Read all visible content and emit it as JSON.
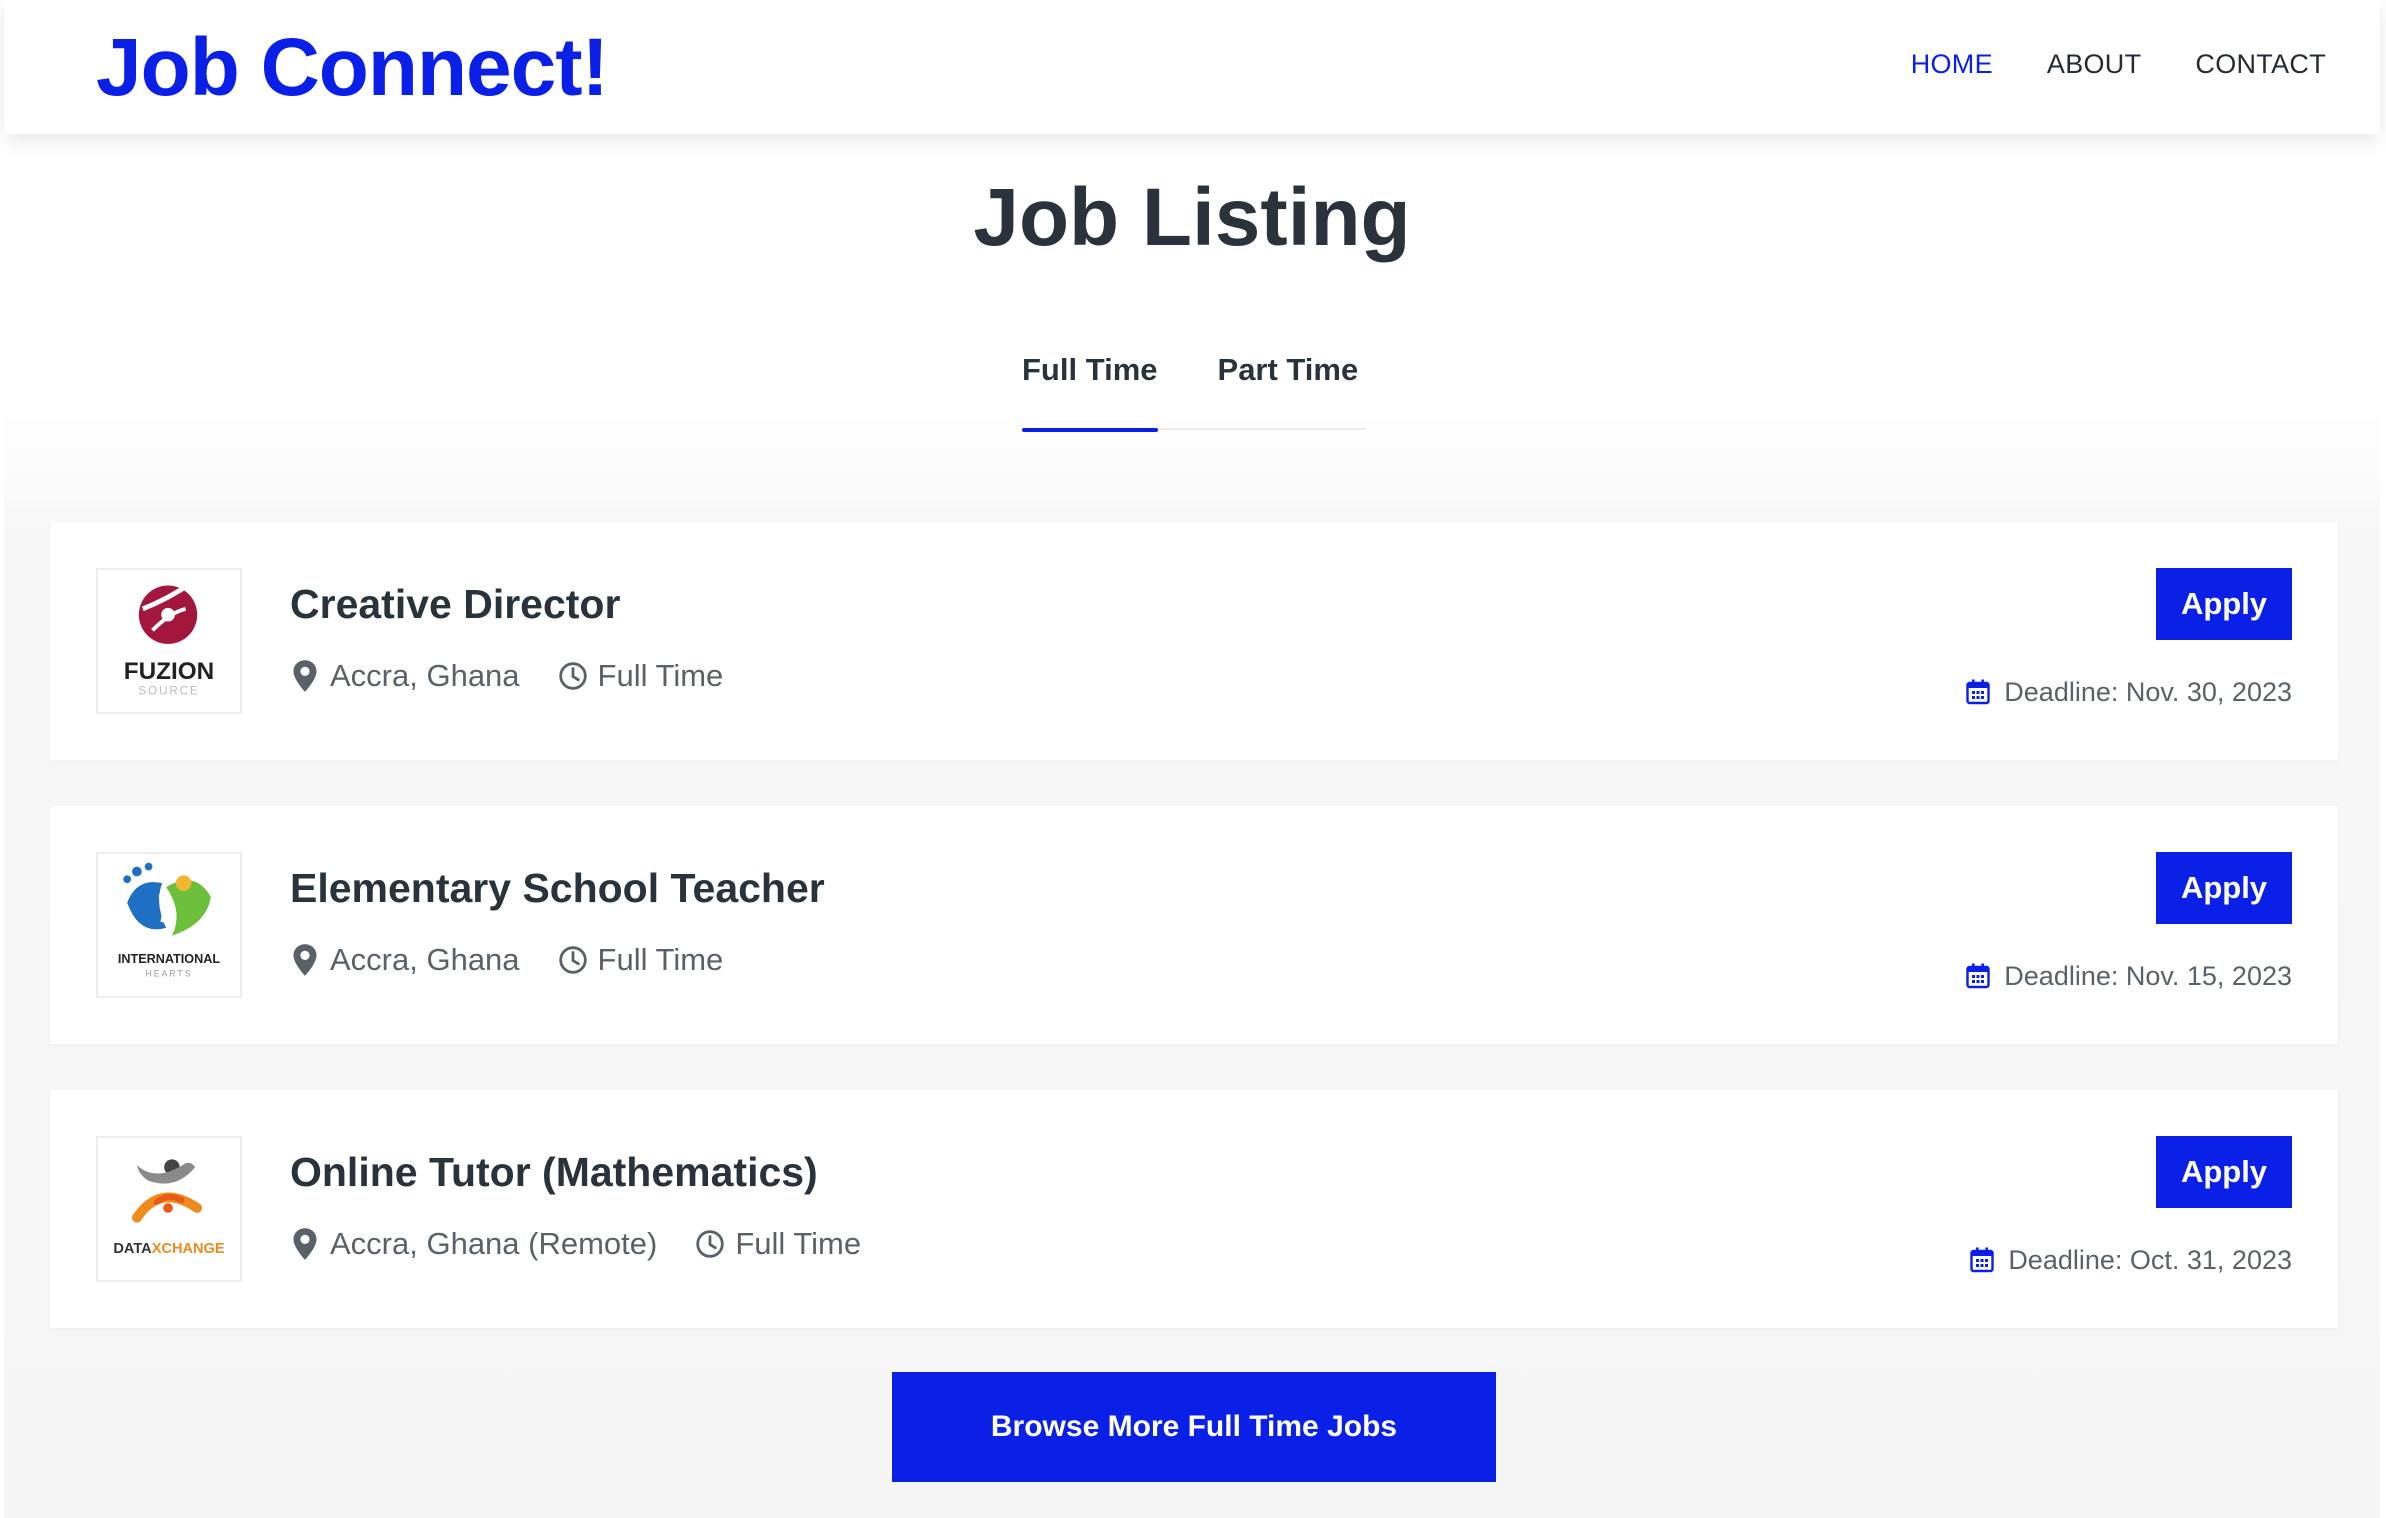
{
  "header": {
    "brand": "Job Connect!",
    "nav": [
      {
        "label": "HOME",
        "active": true
      },
      {
        "label": "ABOUT",
        "active": false
      },
      {
        "label": "CONTACT",
        "active": false
      }
    ]
  },
  "main": {
    "title": "Job Listing",
    "tabs": [
      {
        "label": "Full Time",
        "active": true
      },
      {
        "label": "Part Time",
        "active": false
      }
    ],
    "jobs": [
      {
        "title": "Creative Director",
        "location": "Accra, Ghana",
        "type": "Full Time",
        "apply_label": "Apply",
        "deadline": "Deadline: Nov. 30, 2023",
        "logo": {
          "name": "FUZION",
          "tagline": "SOURCE",
          "icon": "fuzion-logo"
        }
      },
      {
        "title": "Elementary School Teacher",
        "location": "Accra, Ghana",
        "type": "Full Time",
        "apply_label": "Apply",
        "deadline": "Deadline: Nov. 15, 2023",
        "logo": {
          "name": "INTERNATIONAL",
          "tagline": "HEARTS",
          "icon": "international-hearts-logo"
        }
      },
      {
        "title": "Online Tutor (Mathematics)",
        "location": "Accra, Ghana (Remote)",
        "type": "Full Time",
        "apply_label": "Apply",
        "deadline": "Deadline: Oct. 31, 2023",
        "logo": {
          "name_part1": "DATA",
          "name_part2": "XCHANGE",
          "icon": "dataxchange-logo"
        }
      }
    ],
    "browse_label": "Browse More Full Time Jobs"
  },
  "colors": {
    "accent": "#0a20e6",
    "text_dark": "#2a333c",
    "text_muted": "#5a6169"
  },
  "icons": {
    "location": "map-pin-icon",
    "job_type": "clock-icon",
    "deadline": "calendar-icon"
  }
}
